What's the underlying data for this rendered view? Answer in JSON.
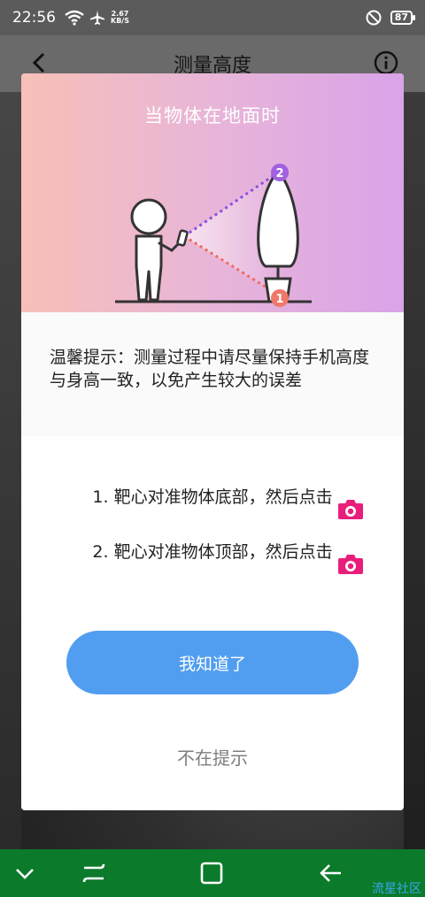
{
  "status_bar": {
    "time": "22:56",
    "net_speed_value": "2.67",
    "net_speed_unit": "KB/S",
    "battery": "87"
  },
  "header": {
    "title": "测量高度"
  },
  "dialog": {
    "banner_title": "当物体在地面时",
    "tip": "温馨提示：测量过程中请尽量保持手机高度与身高一致，以免产生较大的误差",
    "steps": [
      "1. 靶心对准物体底部，然后点击",
      "2. 靶心对准物体顶部，然后点击"
    ],
    "illustration_markers": [
      "1",
      "2"
    ],
    "ok_label": "我知道了",
    "no_remind_label": "不在提示"
  },
  "colors": {
    "button": "#519ef0",
    "camera_icon": "#e91e7a",
    "nav_bar": "#0b7a2a"
  },
  "watermark": "流星社区"
}
